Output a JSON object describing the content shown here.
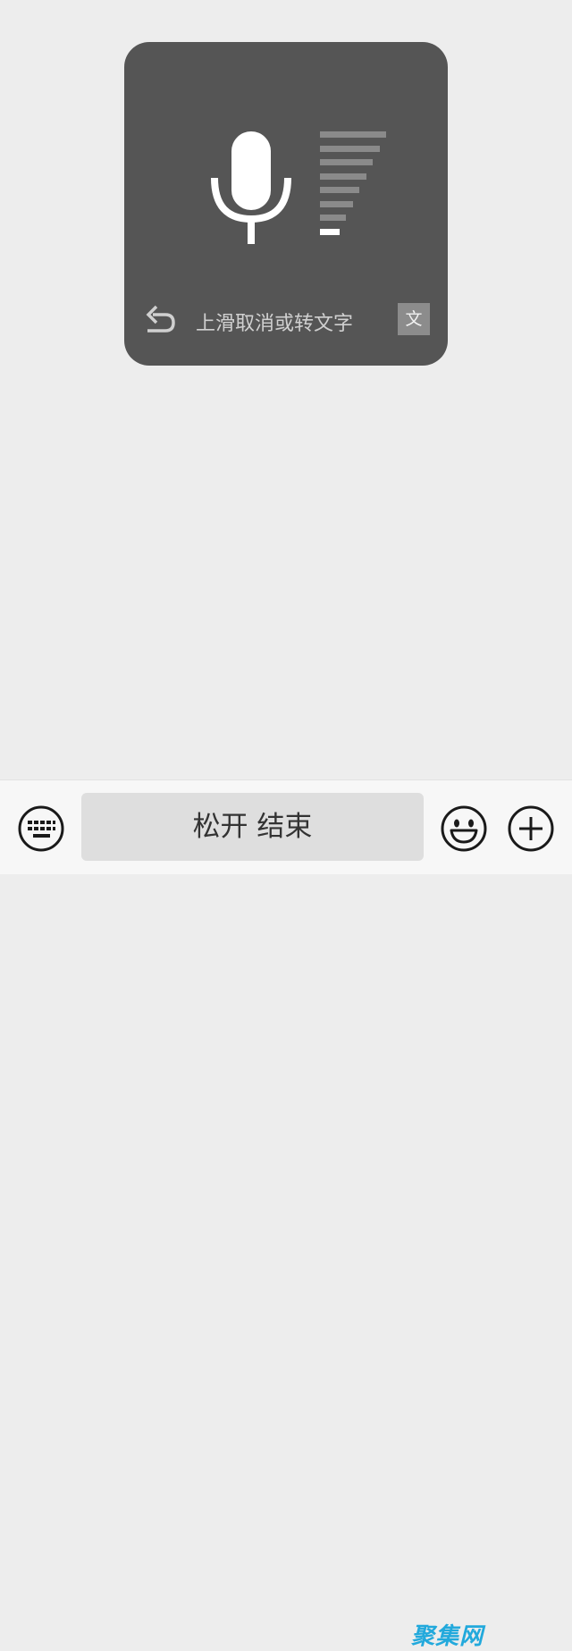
{
  "recording_overlay": {
    "hint_text": "上滑取消或转文字",
    "to_text_label": "文",
    "volume_levels_total": 8,
    "volume_levels_active": 1
  },
  "toolbar": {
    "talk_button_label": "松开 结束"
  },
  "watermark": {
    "text": "聚集网",
    "color": "#22a9dc"
  },
  "icons": {
    "microphone": "microphone-icon",
    "undo": "undo-arrow-icon",
    "keyboard": "keyboard-icon",
    "emoji": "smiley-icon",
    "plus": "plus-circle-icon"
  },
  "colors": {
    "background": "#ededed",
    "overlay": "#555555",
    "level_inactive": "#8a8a8a",
    "level_active": "#ffffff"
  }
}
